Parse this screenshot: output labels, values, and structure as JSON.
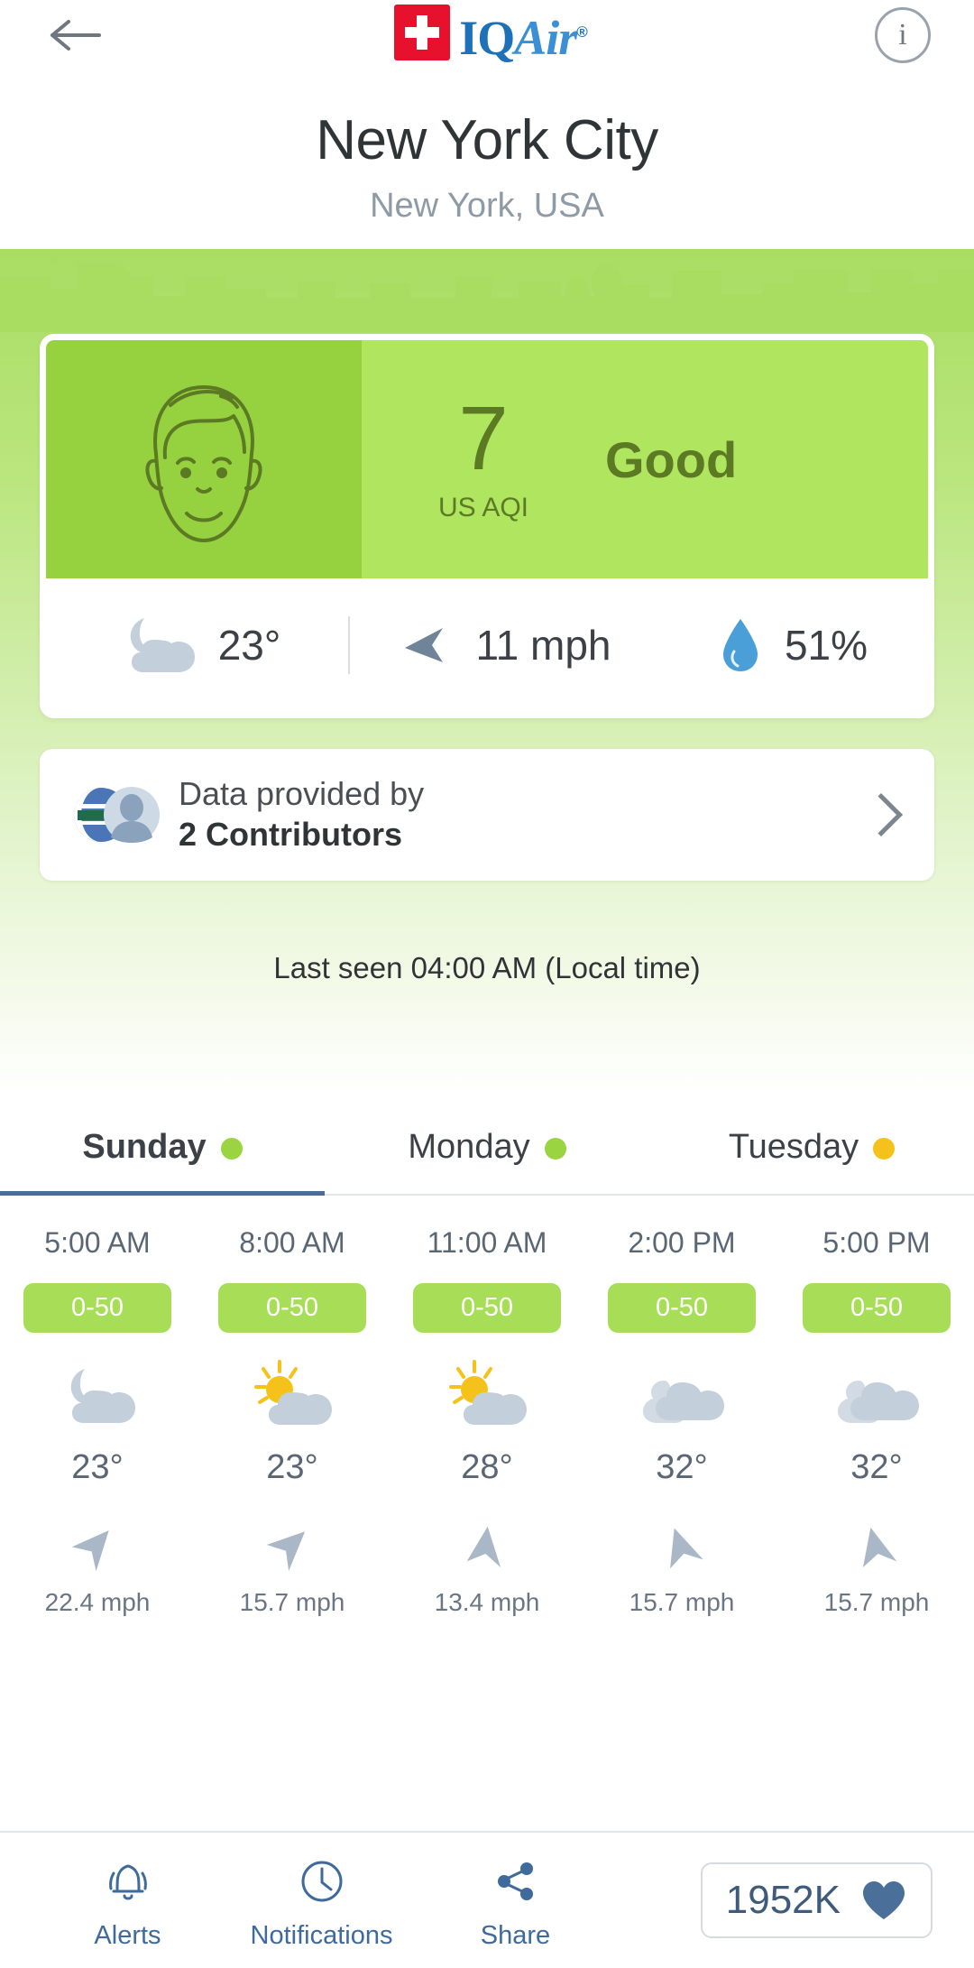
{
  "header": {
    "back_icon": "arrow-left-icon",
    "info_icon": "info-icon",
    "info_glyph": "i",
    "logo_text_iq": "IQ",
    "logo_text_air": "Air",
    "logo_registered": "®"
  },
  "location": {
    "city": "New York City",
    "region": "New York, USA"
  },
  "aqi": {
    "value": "7",
    "unit": "US AQI",
    "category": "Good",
    "face_icon": "happy-face-icon",
    "card_dark_green": "#96d13f",
    "card_light_green": "#b0e55f",
    "text_green": "#5b7a23"
  },
  "weather": {
    "condition_icon": "moon-cloud-icon",
    "temperature": "23°",
    "wind_icon": "wind-direction-icon",
    "wind": "11 mph",
    "humidity_icon": "water-drop-icon",
    "humidity": "51%"
  },
  "contributors": {
    "icon": "contributors-avatars-icon",
    "line1": "Data provided by",
    "line2": "2 Contributors",
    "chevron_icon": "chevron-right-icon"
  },
  "last_seen": "Last seen 04:00 AM (Local time)",
  "forecast": {
    "days": [
      {
        "label": "Sunday",
        "dot_color": "#9ad441",
        "active": true
      },
      {
        "label": "Monday",
        "dot_color": "#9ad441",
        "active": false
      },
      {
        "label": "Tuesday",
        "dot_color": "#f5c21b",
        "active": false
      }
    ],
    "hours": [
      {
        "time": "5:00 AM",
        "aqi_range": "0-50",
        "badge_color": "#a8de57",
        "icon": "moon-cloud-icon",
        "temp": "23°",
        "wind": "22.4 mph",
        "wind_dir": 135
      },
      {
        "time": "8:00 AM",
        "aqi_range": "0-50",
        "badge_color": "#a8de57",
        "icon": "sun-cloud-icon",
        "temp": "23°",
        "wind": "15.7 mph",
        "wind_dir": 140
      },
      {
        "time": "11:00 AM",
        "aqi_range": "0-50",
        "badge_color": "#a8de57",
        "icon": "sun-cloud-icon",
        "temp": "28°",
        "wind": "13.4 mph",
        "wind_dir": 100
      },
      {
        "time": "2:00 PM",
        "aqi_range": "0-50",
        "badge_color": "#a8de57",
        "icon": "cloud-icon",
        "temp": "32°",
        "wind": "15.7 mph",
        "wind_dir": 75
      },
      {
        "time": "5:00 PM",
        "aqi_range": "0-50",
        "badge_color": "#a8de57",
        "icon": "cloud-icon",
        "temp": "32°",
        "wind": "15.7 mph",
        "wind_dir": 80
      }
    ]
  },
  "bottom_bar": {
    "items": [
      {
        "label": "Alerts",
        "icon": "bell-icon"
      },
      {
        "label": "Notifications",
        "icon": "clock-icon"
      },
      {
        "label": "Share",
        "icon": "share-icon"
      }
    ],
    "like_count": "1952K",
    "like_icon": "heart-icon",
    "accent_color": "#3f6a9c"
  }
}
